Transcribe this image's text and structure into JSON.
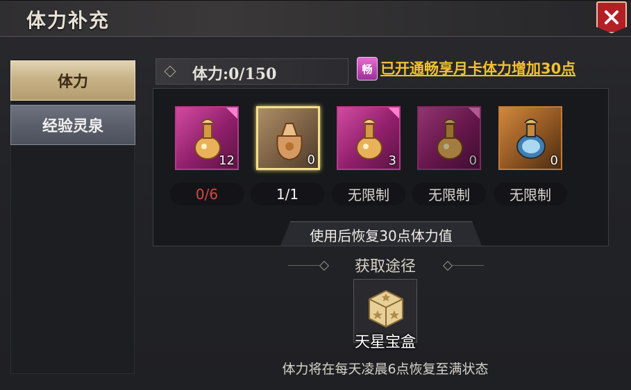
{
  "window": {
    "title": "体力补充"
  },
  "tabs": [
    {
      "label": "体力",
      "active": true
    },
    {
      "label": "经验灵泉",
      "active": false
    }
  ],
  "stamina": {
    "label": "体力:0/150"
  },
  "vip": {
    "icon_text": "畅",
    "link_text": "已开通畅享月卡体力增加30点",
    "link_color": "#f2c12e"
  },
  "items": [
    {
      "count": "12",
      "limit": "0/6",
      "icon": "potion-flask-icon",
      "rarity": "pink"
    },
    {
      "count": "0",
      "limit": "1/1",
      "icon": "potion-bag-icon",
      "rarity": "tan",
      "selected": true
    },
    {
      "count": "3",
      "limit": "无限制",
      "icon": "potion-flask-icon",
      "rarity": "pink"
    },
    {
      "count": "0",
      "limit": "无限制",
      "icon": "potion-flask-icon",
      "rarity": "pink"
    },
    {
      "count": "0",
      "limit": "无限制",
      "icon": "potion-bottle-icon",
      "rarity": "orange"
    }
  ],
  "description": "使用后恢复30点体力值",
  "source": {
    "title": "获取途径",
    "item_label": "天星宝盒",
    "item_icon": "star-chest-icon"
  },
  "footer_note": "体力将在每天凌晨6点恢复至满状态",
  "colors": {
    "accent_red": "#b21f25",
    "limit_red": "#d34a40",
    "tab_active": "#c7b287"
  }
}
